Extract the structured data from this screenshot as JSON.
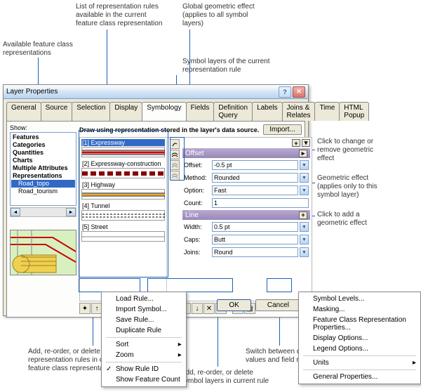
{
  "annotations": {
    "a1": "List of representation rules\navailable in the current\nfeature class representation",
    "a2": "Global geometric effect\n(applies to all symbol\nlayers)",
    "a3": "Available feature class\nrepresentations",
    "a4": "Symbol layers of the current\nrepresentation rule",
    "a5": "Click to change or\nremove geometric\neffect",
    "a6": "Geometric effect\n(applies only to this\nsymbol layer)",
    "a7": "Click to add a\ngeometric effect",
    "a8": "Add, re-order, or delete\nrepresentation rules in current\nfeature class representation",
    "a9": "Add, re-order, or delete\nsymbol layers in current rule",
    "a10": "Switch between default\nvalues and field mapping view"
  },
  "dialog": {
    "title": "Layer Properties",
    "tabs": [
      "General",
      "Source",
      "Selection",
      "Display",
      "Symbology",
      "Fields",
      "Definition Query",
      "Labels",
      "Joins & Relates",
      "Time",
      "HTML Popup"
    ],
    "active_tab": 4,
    "main_title": "Draw using representation stored in the layer's data source.",
    "import_label": "Import...",
    "show_label": "Show:",
    "show_items": [
      "Features",
      "Categories",
      "Quantities",
      "Charts",
      "Multiple Attributes",
      "Representations"
    ],
    "reps": [
      "Road_topo",
      "Road_tourism"
    ],
    "selected_rep": 0,
    "rules": [
      {
        "label": "[1] Expressway"
      },
      {
        "label": "[2] Expressway-construction"
      },
      {
        "label": "[3] Highway"
      },
      {
        "label": "[4] Tunnel"
      },
      {
        "label": "[5] Street"
      }
    ],
    "selected_rule": 0,
    "sections": {
      "offset": {
        "title": "Offset",
        "rows": [
          {
            "label": "Offset:",
            "value": "-0.5 pt",
            "type": "input"
          },
          {
            "label": "Method:",
            "value": "Rounded",
            "type": "select"
          },
          {
            "label": "Option:",
            "value": "Fast",
            "type": "select"
          },
          {
            "label": "Count:",
            "value": "1",
            "type": "input"
          }
        ]
      },
      "line": {
        "title": "Line",
        "rows": [
          {
            "label": "Width:",
            "value": "0.5 pt",
            "type": "input"
          },
          {
            "label": "Caps:",
            "value": "Butt",
            "type": "select"
          },
          {
            "label": "Joins:",
            "value": "Round",
            "type": "select"
          }
        ]
      }
    },
    "ok": "OK",
    "cancel": "Cancel"
  },
  "menu1": {
    "items": [
      "Load Rule...",
      "Import Symbol...",
      "Save Rule...",
      "Duplicate Rule"
    ],
    "items2": [
      "Sort",
      "Zoom"
    ],
    "items3": [
      "Show Rule ID",
      "Show Feature Count"
    ]
  },
  "menu2": {
    "items": [
      "Symbol Levels...",
      "Masking...",
      "Feature Class Representation Properties...",
      "Display Options...",
      "Legend Options..."
    ],
    "items2": [
      "Units"
    ],
    "items3": [
      "General Properties..."
    ]
  }
}
